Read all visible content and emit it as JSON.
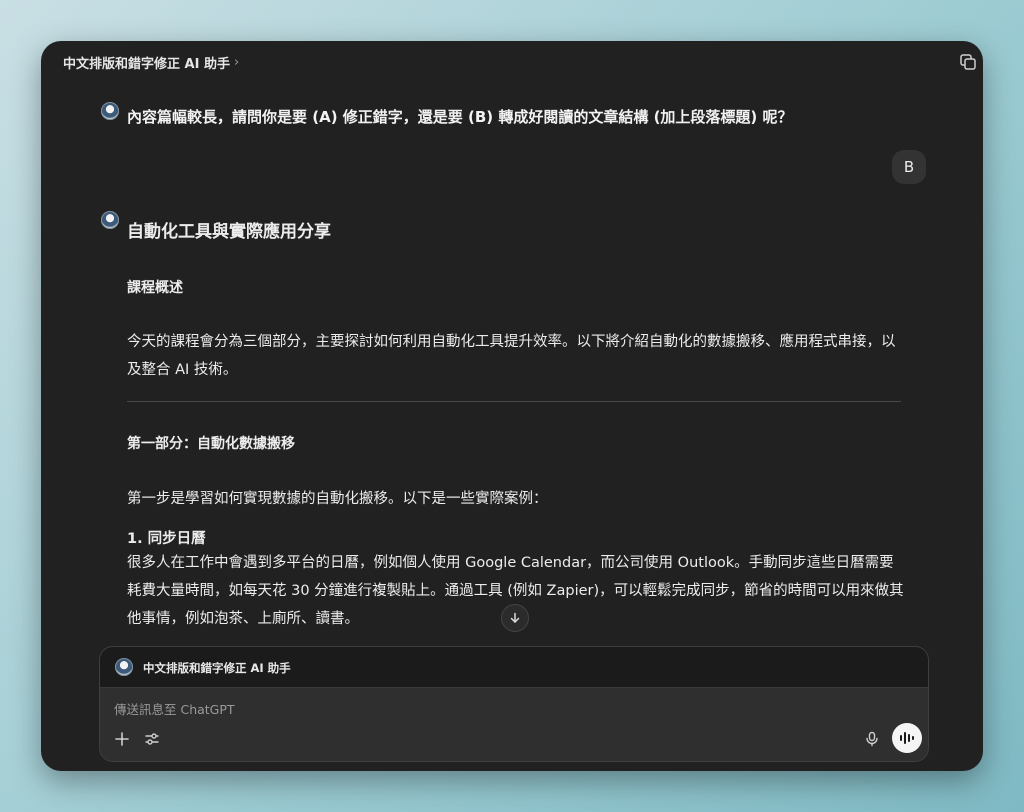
{
  "app": {
    "title": "中文排版和錯字修正 AI 助手",
    "title_chevron": "›"
  },
  "conversation": {
    "question": "內容篇幅較長，請問你是要 (A) 修正錯字，還是要 (B) 轉成好閱讀的文章結構 (加上段落標題) 呢？",
    "user_reply": "B",
    "response": {
      "heading": "自動化工具與實際應用分享",
      "section1_title": "課程概述",
      "section1_body": "今天的課程會分為三個部分，主要探討如何利用自動化工具提升效率。以下將介紹自動化的數據搬移、應用程式串接，以及整合 AI 技術。",
      "section2_title": "第一部分：自動化數據搬移",
      "section2_intro": "第一步是學習如何實現數據的自動化搬移。以下是一些實際案例：",
      "list_item_1_title": "1. 同步日曆",
      "list_item_1_body": "很多人在工作中會遇到多平台的日曆，例如個人使用 Google Calendar，而公司使用 Outlook。手動同步這些日曆需要耗費大量時間，如每天花 30 分鐘進行複製貼上。通過工具 (例如 Zapier)，可以輕鬆完成同步，節省的時間可以用來做其他事情，例如泡茶、上廁所、讀書。"
    }
  },
  "composer": {
    "gpt_name": "中文排版和錯字修正 AI 助手",
    "placeholder": "傳送訊息至 ChatGPT"
  },
  "icons": {
    "scroll_down": "arrow-down-icon",
    "plus": "plus-icon",
    "tools": "sliders-icon",
    "mic": "microphone-icon",
    "voice": "voice-mode-icon",
    "copy": "copy-icon"
  },
  "colors": {
    "window_bg": "#212121",
    "composer_bg": "#2f2f2f",
    "text": "#ececec",
    "muted": "#9a9a9a"
  }
}
